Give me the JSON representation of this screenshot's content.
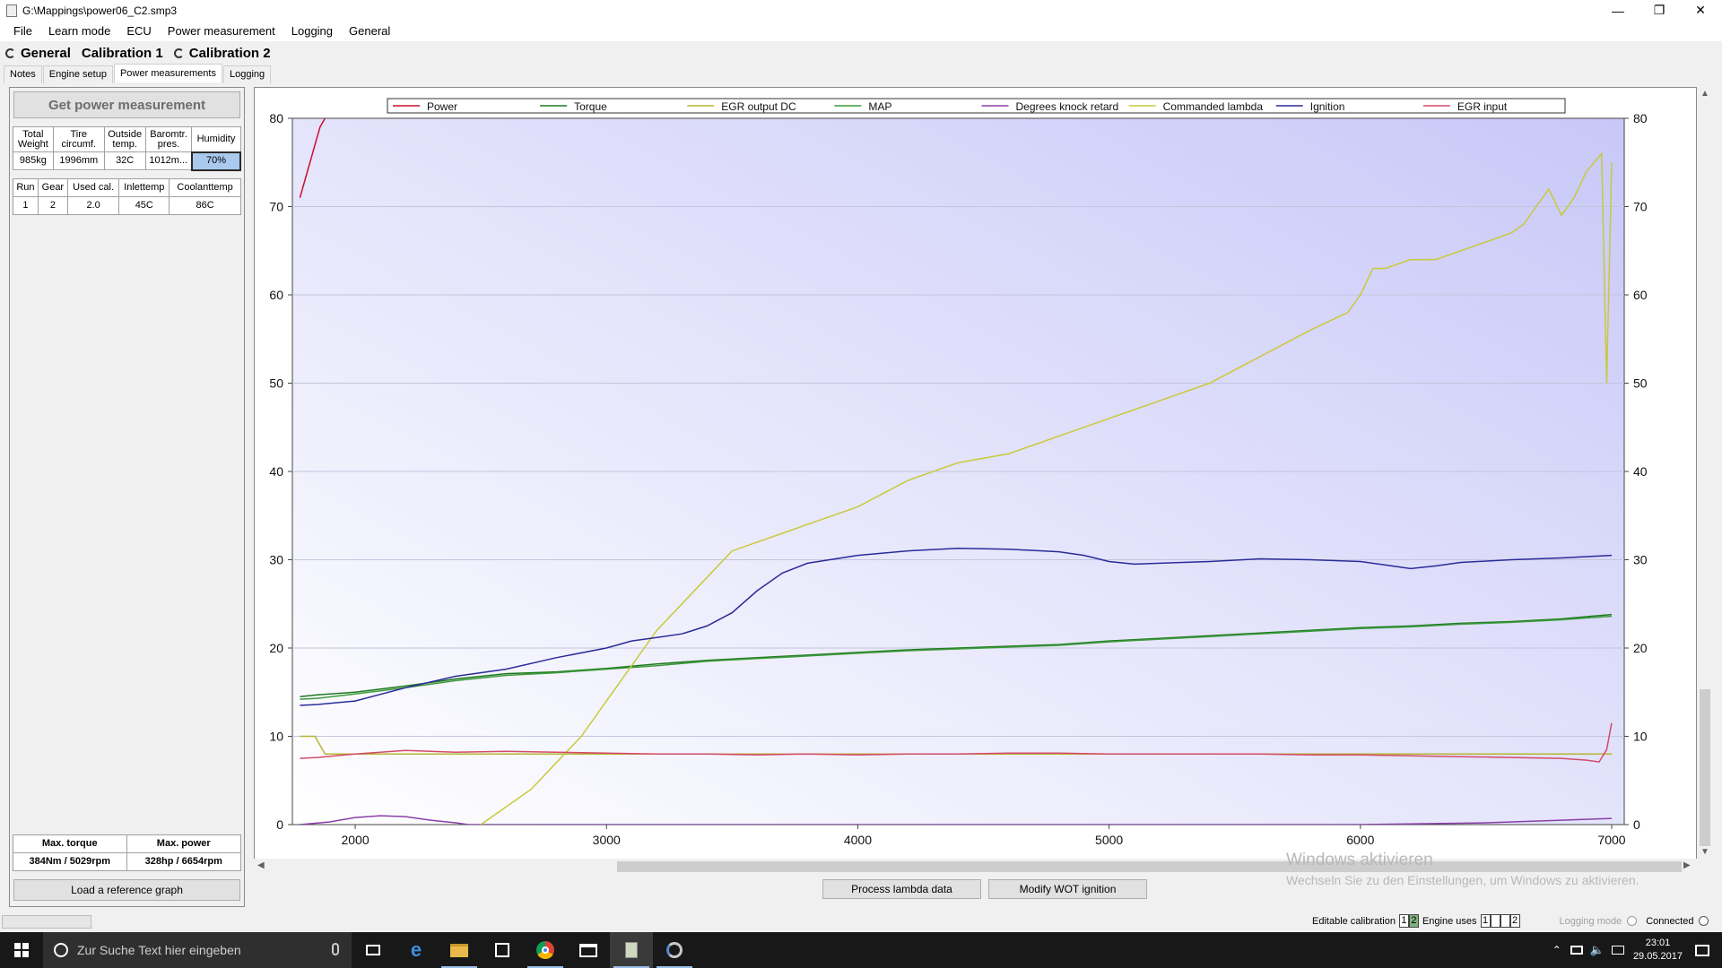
{
  "window": {
    "title": "G:\\Mappings\\power06_C2.smp3",
    "minimize": "—",
    "maximize": "❐",
    "close": "✕"
  },
  "menu": [
    "File",
    "Learn mode",
    "ECU",
    "Power measurement",
    "Logging",
    "General"
  ],
  "calibration_tabs": [
    "General",
    "Calibration 1",
    "Calibration 2"
  ],
  "sub_tabs": [
    "Notes",
    "Engine setup",
    "Power measurements",
    "Logging"
  ],
  "left_panel": {
    "get_button": "Get power measurement",
    "params_headers": [
      "Total Weight",
      "Tire circumf.",
      "Outside temp.",
      "Baromtr. pres.",
      "Humidity"
    ],
    "params_values": [
      "985kg",
      "1996mm",
      "32C",
      "1012m...",
      "70%"
    ],
    "runs_headers": [
      "Run",
      "Gear",
      "Used cal.",
      "Inlettemp",
      "Coolanttemp"
    ],
    "runs": [
      [
        "1",
        "2",
        "2.0",
        "45C",
        "86C"
      ]
    ],
    "max_headers": [
      "Max. torque",
      "Max. power"
    ],
    "max_values": [
      "384Nm / 5029rpm",
      "328hp / 6654rpm"
    ],
    "reference_button": "Load a reference graph"
  },
  "chart_data": {
    "type": "line",
    "xlim": [
      1750,
      7050
    ],
    "ylim": [
      0,
      80
    ],
    "x_ticks": [
      2000,
      3000,
      4000,
      5000,
      6000,
      7000
    ],
    "y_ticks": [
      0,
      10,
      20,
      30,
      40,
      50,
      60,
      70,
      80
    ],
    "legend_position": "top",
    "grid": true,
    "series": [
      {
        "name": "Power",
        "color": "#c8102e",
        "x": [
          1780,
          1800,
          1830,
          1860,
          1900
        ],
        "y": [
          71,
          73,
          76,
          79,
          81
        ]
      },
      {
        "name": "Torque",
        "color": "#1f7a1f",
        "x": [
          1780,
          1850,
          2000,
          2200,
          2400,
          2600,
          2800,
          3000,
          3200,
          3400,
          3600,
          3800,
          4000,
          4200,
          4400,
          4600,
          4800,
          5000,
          5200,
          5400,
          5600,
          5800,
          6000,
          6200,
          6400,
          6600,
          6800,
          7000
        ],
        "y": [
          14.5,
          14.7,
          15.0,
          15.7,
          16.5,
          17.1,
          17.3,
          17.7,
          18.2,
          18.6,
          18.9,
          19.2,
          19.5,
          19.8,
          20.0,
          20.2,
          20.4,
          20.8,
          21.1,
          21.4,
          21.7,
          22.0,
          22.3,
          22.5,
          22.8,
          23.0,
          23.3,
          23.8
        ]
      },
      {
        "name": "EGR output DC",
        "color": "#b5b531",
        "x": [
          1780,
          1840,
          1880,
          2000,
          2500,
          2800,
          3000,
          3200,
          3300,
          3400,
          3500,
          3600,
          3700,
          3800,
          3900,
          4000,
          4200,
          4400,
          4600,
          4800,
          5000,
          5200,
          5400,
          5600,
          5800,
          5950,
          6050,
          6200,
          6400,
          6500,
          6600,
          6700,
          6800,
          6900,
          6950,
          6980,
          7000
        ],
        "y": [
          10,
          10,
          8,
          8,
          8,
          8,
          8,
          8,
          8,
          8,
          8,
          8,
          8,
          8,
          8,
          8,
          8,
          8,
          8,
          8,
          8,
          8,
          8,
          8,
          8,
          8,
          8,
          8,
          8,
          8,
          8,
          8,
          8,
          8,
          8,
          8,
          8
        ]
      },
      {
        "name": "MAP",
        "color": "#3c9a3c",
        "x": [
          1780,
          1850,
          2000,
          2200,
          2400,
          2600,
          2800,
          3000,
          3200,
          3400,
          3600,
          3800,
          4000,
          4200,
          4400,
          4600,
          4800,
          5000,
          5200,
          5400,
          5600,
          5800,
          6000,
          6200,
          6400,
          6600,
          6800,
          7000
        ],
        "y": [
          14.2,
          14.3,
          14.8,
          15.5,
          16.3,
          16.9,
          17.2,
          17.6,
          18.0,
          18.5,
          18.8,
          19.1,
          19.4,
          19.7,
          19.9,
          20.1,
          20.3,
          20.7,
          21.0,
          21.3,
          21.6,
          21.9,
          22.2,
          22.4,
          22.7,
          22.9,
          23.2,
          23.6
        ]
      },
      {
        "name": "Degrees knock retard",
        "color": "#8a3fa8",
        "x": [
          1780,
          1900,
          2000,
          2100,
          2200,
          2300,
          2400,
          2450,
          2500,
          3000,
          4000,
          5000,
          6000,
          6500,
          6800,
          7000
        ],
        "y": [
          0,
          0.3,
          0.8,
          1.0,
          0.9,
          0.5,
          0.2,
          0,
          0,
          0,
          0,
          0,
          0,
          0.2,
          0.5,
          0.7
        ]
      },
      {
        "name": "Commanded lambda",
        "color": "#c9c93a",
        "x": [
          2500,
          2600,
          2700,
          2800,
          2900,
          3000,
          3100,
          3200,
          3300,
          3400,
          3500,
          3600,
          3700,
          3800,
          3900,
          4000,
          4200,
          4400,
          4600,
          4800,
          5000,
          5200,
          5400,
          5600,
          5800,
          5950,
          6000,
          6050,
          6100,
          6200,
          6300,
          6400,
          6500,
          6600,
          6650,
          6700,
          6750,
          6800,
          6850,
          6900,
          6930,
          6960,
          6980,
          7000
        ],
        "y": [
          0,
          2,
          4,
          7,
          10,
          14,
          18,
          22,
          25,
          28,
          31,
          32,
          33,
          34,
          35,
          36,
          39,
          41,
          42,
          44,
          46,
          48,
          50,
          53,
          56,
          58,
          60,
          63,
          63,
          64,
          64,
          65,
          66,
          67,
          68,
          70,
          72,
          69,
          71,
          74,
          75,
          76,
          50,
          75
        ]
      },
      {
        "name": "Ignition",
        "color": "#2b2b9a",
        "x": [
          1780,
          1850,
          2000,
          2200,
          2400,
          2600,
          2800,
          3000,
          3100,
          3200,
          3300,
          3400,
          3500,
          3600,
          3700,
          3800,
          4000,
          4200,
          4400,
          4600,
          4800,
          4900,
          5000,
          5100,
          5200,
          5400,
          5600,
          5800,
          6000,
          6100,
          6200,
          6300,
          6400,
          6600,
          6800,
          7000
        ],
        "y": [
          13.5,
          13.6,
          14.0,
          15.5,
          16.8,
          17.6,
          18.9,
          20.0,
          20.8,
          21.2,
          21.6,
          22.5,
          24.0,
          26.5,
          28.5,
          29.6,
          30.5,
          31.0,
          31.3,
          31.2,
          30.9,
          30.5,
          29.8,
          29.5,
          29.6,
          29.8,
          30.1,
          30.0,
          29.8,
          29.4,
          29.0,
          29.3,
          29.7,
          30.0,
          30.2,
          30.5
        ]
      },
      {
        "name": "EGR input",
        "color": "#d44a6a",
        "x": [
          1780,
          1850,
          2000,
          2200,
          2400,
          2600,
          2800,
          3000,
          3200,
          3400,
          3600,
          3800,
          4000,
          4200,
          4400,
          4600,
          4800,
          5000,
          5200,
          5400,
          5600,
          5800,
          6000,
          6200,
          6400,
          6600,
          6800,
          6900,
          6950,
          6980,
          7000
        ],
        "y": [
          7.5,
          7.6,
          8.0,
          8.4,
          8.2,
          8.3,
          8.2,
          8.1,
          8.0,
          8.0,
          7.9,
          8.0,
          7.9,
          8.0,
          8.0,
          8.1,
          8.1,
          8.0,
          8.0,
          8.0,
          8.0,
          7.9,
          7.9,
          7.8,
          7.7,
          7.6,
          7.5,
          7.3,
          7.1,
          8.5,
          11.5
        ]
      }
    ]
  },
  "bottom_buttons": {
    "process_lambda": "Process lambda data",
    "modify_wot": "Modify WOT ignition"
  },
  "watermark": {
    "line1": "Windows aktivieren",
    "line2": "Wechseln Sie zu den Einstellungen, um Windows zu aktivieren."
  },
  "statusbar": {
    "editable_calibration": "Editable calibration",
    "editable_values": [
      "1",
      "2"
    ],
    "engine_uses": "Engine uses",
    "engine_values": [
      "1",
      "",
      "",
      "2"
    ],
    "logging_mode": "Logging mode",
    "connected": "Connected"
  },
  "taskbar": {
    "search_placeholder": "Zur Suche Text hier eingeben",
    "time": "23:01",
    "date": "29.05.2017"
  }
}
